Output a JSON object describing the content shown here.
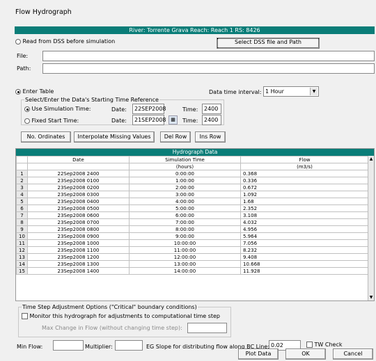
{
  "window": {
    "title": "Flow Hydrograph"
  },
  "header": {
    "location": "River: Torrente Grava  Reach: Reach 1  RS: 8426"
  },
  "dss": {
    "read_label": "Read from DSS before simulation",
    "select_button": "Select DSS file and Path",
    "file_label": "File:",
    "path_label": "Path:",
    "file_value": "",
    "path_value": ""
  },
  "enter_table": {
    "label": "Enter Table",
    "interval_label": "Data time interval:",
    "interval_value": "1 Hour",
    "group_label": "Select/Enter the Data's Starting Time Reference",
    "use_sim_label": "Use Simulation Time:",
    "fixed_label": "Fixed Start Time:",
    "date_label": "Date:",
    "time_label": "Time:",
    "sim_date": "22SEP2008",
    "sim_time": "2400",
    "fixed_date": "21SEP2008",
    "fixed_time": "2400"
  },
  "toolbar": {
    "no_ordinates": "No. Ordinates",
    "interpolate": "Interpolate Missing Values",
    "del_row": "Del Row",
    "ins_row": "Ins Row"
  },
  "grid": {
    "title": "Hydrograph Data",
    "col_date": "Date",
    "col_sim": "Simulation Time",
    "col_flow": "Flow",
    "unit_sim": "(hours)",
    "unit_flow": "(m3/s)",
    "rows": [
      {
        "n": "1",
        "date": "22Sep2008 2400",
        "sim": "0:00:00",
        "flow": "0.368"
      },
      {
        "n": "2",
        "date": "23Sep2008 0100",
        "sim": "1:00:00",
        "flow": "0.336"
      },
      {
        "n": "3",
        "date": "23Sep2008 0200",
        "sim": "2:00:00",
        "flow": "0.672"
      },
      {
        "n": "4",
        "date": "23Sep2008 0300",
        "sim": "3:00:00",
        "flow": "1.092"
      },
      {
        "n": "5",
        "date": "23Sep2008 0400",
        "sim": "4:00:00",
        "flow": "1.68"
      },
      {
        "n": "6",
        "date": "23Sep2008 0500",
        "sim": "5:00:00",
        "flow": "2.352"
      },
      {
        "n": "7",
        "date": "23Sep2008 0600",
        "sim": "6:00:00",
        "flow": "3.108"
      },
      {
        "n": "8",
        "date": "23Sep2008 0700",
        "sim": "7:00:00",
        "flow": "4.032"
      },
      {
        "n": "9",
        "date": "23Sep2008 0800",
        "sim": "8:00:00",
        "flow": "4.956"
      },
      {
        "n": "10",
        "date": "23Sep2008 0900",
        "sim": "9:00:00",
        "flow": "5.964"
      },
      {
        "n": "11",
        "date": "23Sep2008 1000",
        "sim": "10:00:00",
        "flow": "7.056"
      },
      {
        "n": "12",
        "date": "23Sep2008 1100",
        "sim": "11:00:00",
        "flow": "8.232"
      },
      {
        "n": "13",
        "date": "23Sep2008 1200",
        "sim": "12:00:00",
        "flow": "9.408"
      },
      {
        "n": "14",
        "date": "23Sep2008 1300",
        "sim": "13:00:00",
        "flow": "10.668"
      },
      {
        "n": "15",
        "date": "23Sep2008 1400",
        "sim": "14:00:00",
        "flow": "11.928"
      }
    ]
  },
  "time_step": {
    "group_label": "Time Step Adjustment Options (\"Critical\" boundary conditions)",
    "monitor_label": "Monitor this hydrograph for adjustments to computational time step",
    "max_change_label": "Max Change in Flow (without changing time step):"
  },
  "bottom": {
    "min_flow_label": "Min Flow:",
    "multiplier_label": "Multiplier:",
    "eg_slope_label": "EG Slope for distributing flow along BC Line:",
    "eg_slope_value": "0.02",
    "tw_check_label": "TW Check",
    "plot_data": "Plot Data",
    "ok": "OK",
    "cancel": "Cancel"
  }
}
